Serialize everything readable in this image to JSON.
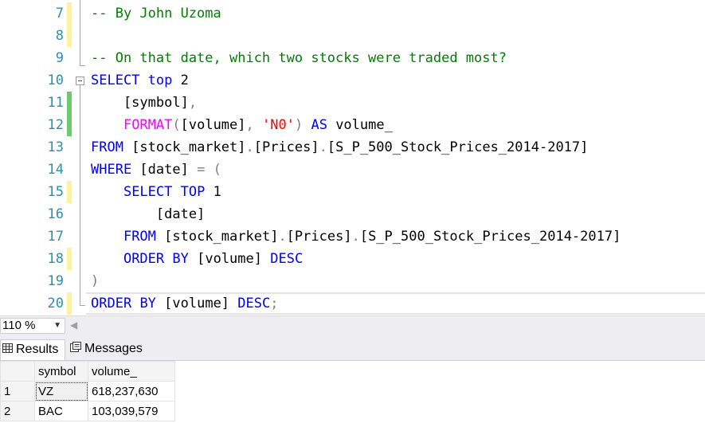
{
  "editor": {
    "lines": [
      {
        "num": "7",
        "marker": "yellow",
        "segments": [
          {
            "cls": "cm",
            "text": "-- By John Uzoma"
          }
        ]
      },
      {
        "num": "8",
        "marker": "yellow",
        "segments": []
      },
      {
        "num": "9",
        "marker": "none",
        "segments": [
          {
            "cls": "cm",
            "text": "-- On that date, which two stocks were traded most?"
          }
        ]
      },
      {
        "num": "10",
        "marker": "none",
        "segments": [
          {
            "cls": "kw",
            "text": "SELECT"
          },
          {
            "cls": "",
            "text": " "
          },
          {
            "cls": "kw",
            "text": "top"
          },
          {
            "cls": "",
            "text": " 2"
          }
        ]
      },
      {
        "num": "11",
        "marker": "green",
        "segments": [
          {
            "cls": "",
            "text": "    [symbol]"
          },
          {
            "cls": "op",
            "text": ","
          }
        ]
      },
      {
        "num": "12",
        "marker": "green",
        "segments": [
          {
            "cls": "",
            "text": "    "
          },
          {
            "cls": "fn",
            "text": "FORMAT"
          },
          {
            "cls": "op",
            "text": "("
          },
          {
            "cls": "",
            "text": "[volume]"
          },
          {
            "cls": "op",
            "text": ","
          },
          {
            "cls": "",
            "text": " "
          },
          {
            "cls": "str",
            "text": "'N0'"
          },
          {
            "cls": "op",
            "text": ")"
          },
          {
            "cls": "",
            "text": " "
          },
          {
            "cls": "kw",
            "text": "AS"
          },
          {
            "cls": "",
            "text": " volume_"
          }
        ]
      },
      {
        "num": "13",
        "marker": "none",
        "segments": [
          {
            "cls": "kw",
            "text": "FROM"
          },
          {
            "cls": "",
            "text": " [stock_market]"
          },
          {
            "cls": "op",
            "text": "."
          },
          {
            "cls": "",
            "text": "[Prices]"
          },
          {
            "cls": "op",
            "text": "."
          },
          {
            "cls": "",
            "text": "[S_P_500_Stock_Prices_2014-2017]"
          }
        ]
      },
      {
        "num": "14",
        "marker": "none",
        "segments": [
          {
            "cls": "kw",
            "text": "WHERE"
          },
          {
            "cls": "",
            "text": " [date] "
          },
          {
            "cls": "op",
            "text": "="
          },
          {
            "cls": "",
            "text": " "
          },
          {
            "cls": "op",
            "text": "("
          }
        ]
      },
      {
        "num": "15",
        "marker": "yellow",
        "segments": [
          {
            "cls": "",
            "text": "    "
          },
          {
            "cls": "kw",
            "text": "SELECT"
          },
          {
            "cls": "",
            "text": " "
          },
          {
            "cls": "kw",
            "text": "TOP"
          },
          {
            "cls": "",
            "text": " 1"
          }
        ]
      },
      {
        "num": "16",
        "marker": "none",
        "segments": [
          {
            "cls": "",
            "text": "        [date]"
          }
        ]
      },
      {
        "num": "17",
        "marker": "none",
        "segments": [
          {
            "cls": "",
            "text": "    "
          },
          {
            "cls": "kw",
            "text": "FROM"
          },
          {
            "cls": "",
            "text": " [stock_market]"
          },
          {
            "cls": "op",
            "text": "."
          },
          {
            "cls": "",
            "text": "[Prices]"
          },
          {
            "cls": "op",
            "text": "."
          },
          {
            "cls": "",
            "text": "[S_P_500_Stock_Prices_2014-2017]"
          }
        ]
      },
      {
        "num": "18",
        "marker": "yellow",
        "segments": [
          {
            "cls": "",
            "text": "    "
          },
          {
            "cls": "kw",
            "text": "ORDER"
          },
          {
            "cls": "",
            "text": " "
          },
          {
            "cls": "kw",
            "text": "BY"
          },
          {
            "cls": "",
            "text": " [volume] "
          },
          {
            "cls": "kw",
            "text": "DESC"
          }
        ]
      },
      {
        "num": "19",
        "marker": "none",
        "segments": [
          {
            "cls": "op",
            "text": ")"
          }
        ]
      },
      {
        "num": "20",
        "marker": "yellow",
        "segments": [
          {
            "cls": "kw",
            "text": "ORDER"
          },
          {
            "cls": "",
            "text": " "
          },
          {
            "cls": "kw",
            "text": "BY"
          },
          {
            "cls": "",
            "text": " [volume] "
          },
          {
            "cls": "kw",
            "text": "DESC"
          },
          {
            "cls": "op",
            "text": ";"
          }
        ]
      }
    ]
  },
  "statusbar": {
    "zoom": "110 %"
  },
  "tabs": [
    {
      "id": "results",
      "label": "Results",
      "icon": "grid-icon",
      "active": true
    },
    {
      "id": "messages",
      "label": "Messages",
      "icon": "messages-icon",
      "active": false
    }
  ],
  "results": {
    "columns": [
      "symbol",
      "volume_"
    ],
    "rows": [
      {
        "num": "1",
        "cells": [
          "VZ",
          "618,237,630"
        ]
      },
      {
        "num": "2",
        "cells": [
          "BAC",
          "103,039,579"
        ]
      }
    ]
  },
  "colors": {
    "keyword": "#0000ff",
    "function": "#ff00ff",
    "string": "#ff0000",
    "comment": "#008000",
    "line_number": "#2b91af",
    "change_saved": "#6ccb6c",
    "change_unsaved": "#fcf49d"
  }
}
